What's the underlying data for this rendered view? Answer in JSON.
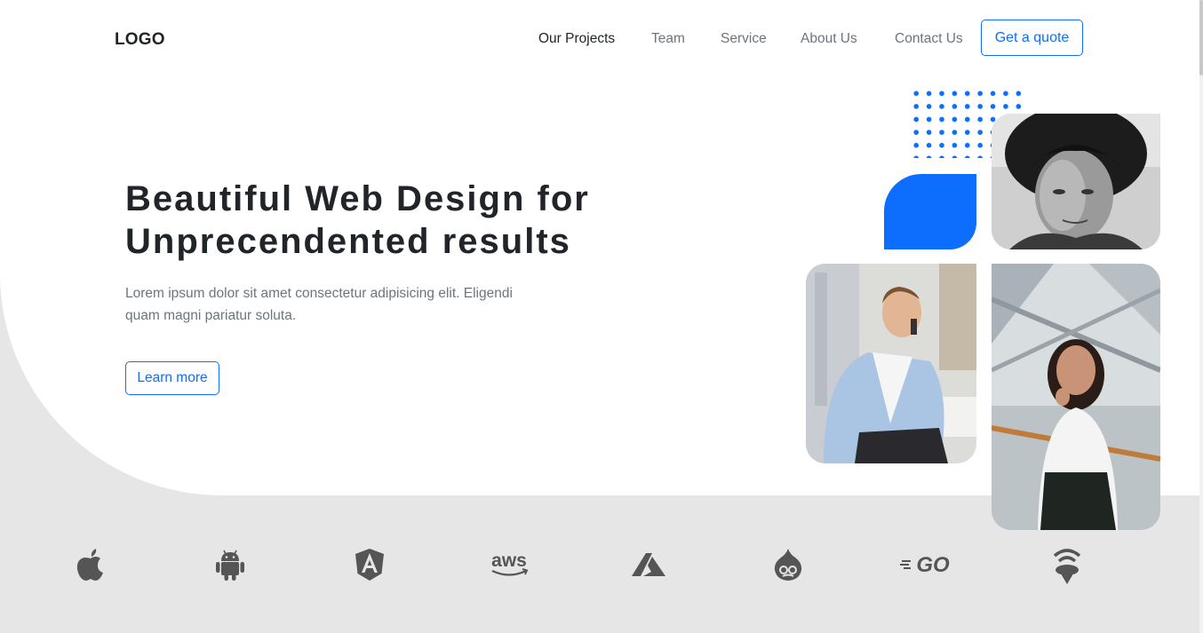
{
  "header": {
    "logo": "LOGO",
    "nav": [
      {
        "label": "Our Projects",
        "active": true
      },
      {
        "label": "Team",
        "active": false
      },
      {
        "label": "Service",
        "active": false
      },
      {
        "label": "About Us",
        "active": false
      },
      {
        "label": "Contact Us",
        "active": false
      }
    ],
    "cta_label": "Get a quote"
  },
  "hero": {
    "title_line1": "Beautiful Web Design for",
    "title_line2": "Unprecendented results",
    "description": "Lorem ipsum dolor sit amet consectetur adipisicing elit. Eligendi quam magni pariatur soluta.",
    "button_label": "Learn more",
    "images": [
      "portrait-curly-hair-photo",
      "businessman-phone-photo",
      "smiling-woman-photo"
    ]
  },
  "brands": [
    "apple-icon",
    "android-icon",
    "angular-icon",
    "aws-icon",
    "azure-icon",
    "drupal-icon",
    "go-icon",
    "kaggle-icon"
  ],
  "colors": {
    "accent": "#0d6efd",
    "text_dark": "#212529",
    "text_muted": "#6c757d",
    "band_background": "#e6e6e6",
    "brand_icon": "#555555"
  }
}
